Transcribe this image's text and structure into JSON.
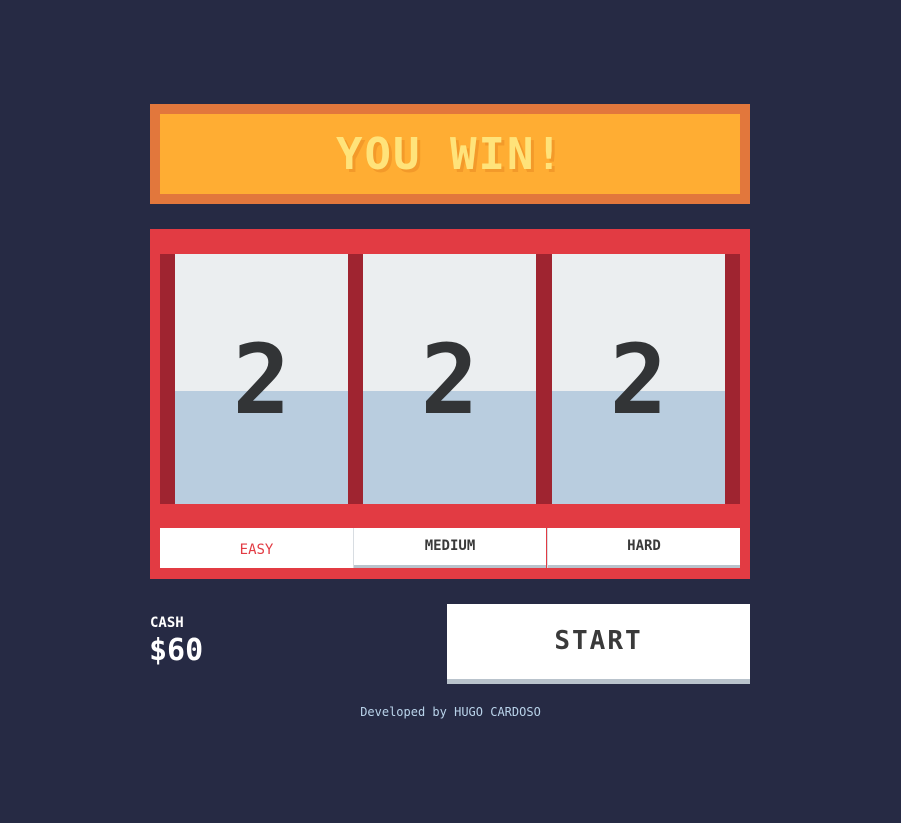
{
  "banner": {
    "text": "YOU WIN!"
  },
  "reels": [
    {
      "symbol": "2"
    },
    {
      "symbol": "2"
    },
    {
      "symbol": "2"
    }
  ],
  "difficulty": {
    "options": [
      {
        "label": "EASY",
        "active": true
      },
      {
        "label": "MEDIUM",
        "active": false
      },
      {
        "label": "HARD",
        "active": false
      }
    ]
  },
  "cash": {
    "label": "CASH",
    "value": "$60"
  },
  "controls": {
    "start_label": "START"
  },
  "footer": {
    "text": "Developed by HUGO CARDOSO"
  },
  "colors": {
    "background": "#262a44",
    "banner_border": "#e2773c",
    "banner_fill": "#ffad33",
    "banner_text": "#ffe37a",
    "machine": "#e23b43",
    "machine_dark": "#9f2430",
    "active_difficulty": "#e23b43"
  }
}
